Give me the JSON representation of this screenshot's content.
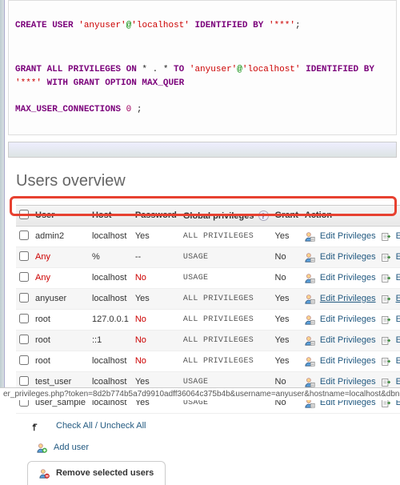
{
  "sql": {
    "line1_kw1": "CREATE USER",
    "line1_str1": "'anyuser'",
    "line1_at": "@",
    "line1_str2": "'localhost'",
    "line1_kw2": "IDENTIFIED BY",
    "line1_str3": "'***'",
    "line1_end": ";",
    "line2_kw1": "GRANT ALL PRIVILEGES ON",
    "line2_star": " * . * ",
    "line2_kw2": "TO",
    "line2_str1": "'anyuser'",
    "line2_at": "@",
    "line2_str2": "'localhost'",
    "line2_kw3": "IDENTIFIED BY",
    "line2_str3": "'***'",
    "line2_kw4": " WITH GRANT OPTION MAX_QUER",
    "line2_tail": "MAX_USER_CONNECTIONS",
    "line2_num": "0",
    "line2_end": " ;"
  },
  "title": "Users overview",
  "cols": {
    "c0": "",
    "c1": "User",
    "c2": "Host",
    "c3": "Password",
    "c4": "Global privileges",
    "c5": "Grant",
    "c6": "Action"
  },
  "help": "?",
  "actions": {
    "edit": "Edit Privileges",
    "export": "Export"
  },
  "rows": [
    {
      "user": "admin2",
      "host": "localhost",
      "pw": "Yes",
      "priv": "ALL PRIVILEGES",
      "grant": "Yes",
      "red": false
    },
    {
      "user": "Any",
      "host": "%",
      "pw": "--",
      "priv": "USAGE",
      "grant": "No",
      "red": true
    },
    {
      "user": "Any",
      "host": "localhost",
      "pw": "No",
      "priv": "USAGE",
      "grant": "No",
      "red": true
    },
    {
      "user": "anyuser",
      "host": "localhost",
      "pw": "Yes",
      "priv": "ALL PRIVILEGES",
      "grant": "Yes",
      "red": false,
      "hl": true
    },
    {
      "user": "root",
      "host": "127.0.0.1",
      "pw": "No",
      "priv": "ALL PRIVILEGES",
      "grant": "Yes",
      "red": false,
      "pwred": true
    },
    {
      "user": "root",
      "host": "::1",
      "pw": "No",
      "priv": "ALL PRIVILEGES",
      "grant": "Yes",
      "red": false,
      "pwred": true
    },
    {
      "user": "root",
      "host": "localhost",
      "pw": "No",
      "priv": "ALL PRIVILEGES",
      "grant": "Yes",
      "red": false,
      "pwred": true
    },
    {
      "user": "test_user",
      "host": "lcoalhost",
      "pw": "Yes",
      "priv": "USAGE",
      "grant": "No",
      "red": false
    },
    {
      "user": "user_sample",
      "host": "localhost",
      "pw": "Yes",
      "priv": "USAGE",
      "grant": "No",
      "red": false
    }
  ],
  "checkall": "Check All / Uncheck All",
  "adduser": "Add user",
  "remove": "Remove selected users",
  "url": "er_privileges.php?token=8d2b774b5a7d9910adff36064c375b4b&username=anyuser&hostname=localhost&dbname=&ta"
}
